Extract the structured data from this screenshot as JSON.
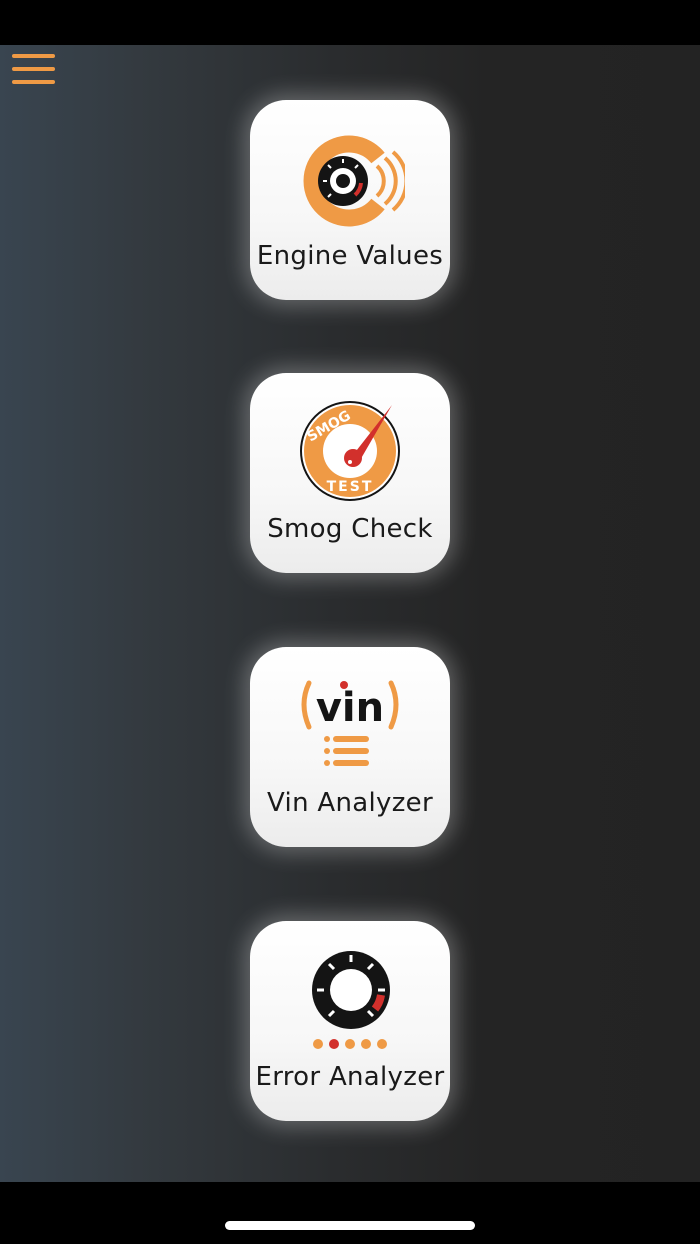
{
  "menu": {
    "icon": "hamburger-menu-icon"
  },
  "tiles": [
    {
      "label": "Engine Values",
      "icon": "engine-gauge-icon"
    },
    {
      "label": "Smog Check",
      "icon": "smog-test-icon",
      "icon_text_top": "SMOG",
      "icon_text_bottom": "TEST"
    },
    {
      "label": "Vin Analyzer",
      "icon": "vin-list-icon",
      "icon_text": "vin"
    },
    {
      "label": "Error Analyzer",
      "icon": "error-gauge-icon"
    }
  ],
  "colors": {
    "accent": "#ef9a45",
    "alert": "#d2302c",
    "dark": "#141414",
    "tile": "#f7f7f7"
  }
}
